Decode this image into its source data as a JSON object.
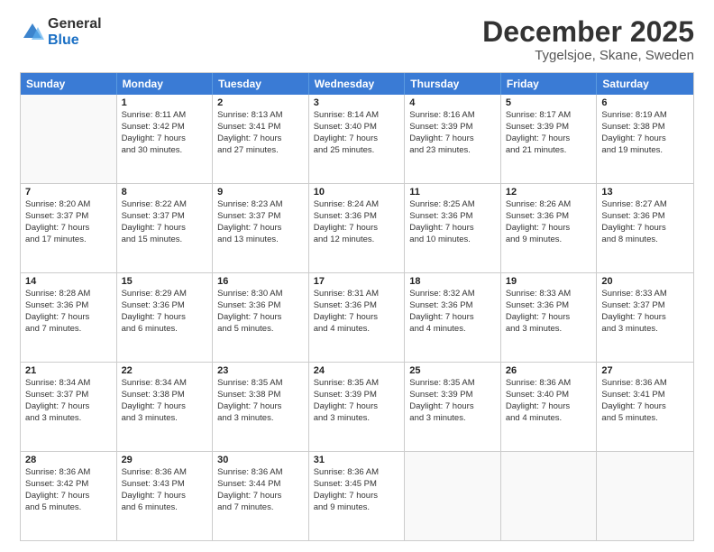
{
  "header": {
    "logo_general": "General",
    "logo_blue": "Blue",
    "month_title": "December 2025",
    "location": "Tygelsjoe, Skane, Sweden"
  },
  "days_of_week": [
    "Sunday",
    "Monday",
    "Tuesday",
    "Wednesday",
    "Thursday",
    "Friday",
    "Saturday"
  ],
  "weeks": [
    [
      {
        "day": "",
        "lines": []
      },
      {
        "day": "1",
        "lines": [
          "Sunrise: 8:11 AM",
          "Sunset: 3:42 PM",
          "Daylight: 7 hours",
          "and 30 minutes."
        ]
      },
      {
        "day": "2",
        "lines": [
          "Sunrise: 8:13 AM",
          "Sunset: 3:41 PM",
          "Daylight: 7 hours",
          "and 27 minutes."
        ]
      },
      {
        "day": "3",
        "lines": [
          "Sunrise: 8:14 AM",
          "Sunset: 3:40 PM",
          "Daylight: 7 hours",
          "and 25 minutes."
        ]
      },
      {
        "day": "4",
        "lines": [
          "Sunrise: 8:16 AM",
          "Sunset: 3:39 PM",
          "Daylight: 7 hours",
          "and 23 minutes."
        ]
      },
      {
        "day": "5",
        "lines": [
          "Sunrise: 8:17 AM",
          "Sunset: 3:39 PM",
          "Daylight: 7 hours",
          "and 21 minutes."
        ]
      },
      {
        "day": "6",
        "lines": [
          "Sunrise: 8:19 AM",
          "Sunset: 3:38 PM",
          "Daylight: 7 hours",
          "and 19 minutes."
        ]
      }
    ],
    [
      {
        "day": "7",
        "lines": [
          "Sunrise: 8:20 AM",
          "Sunset: 3:37 PM",
          "Daylight: 7 hours",
          "and 17 minutes."
        ]
      },
      {
        "day": "8",
        "lines": [
          "Sunrise: 8:22 AM",
          "Sunset: 3:37 PM",
          "Daylight: 7 hours",
          "and 15 minutes."
        ]
      },
      {
        "day": "9",
        "lines": [
          "Sunrise: 8:23 AM",
          "Sunset: 3:37 PM",
          "Daylight: 7 hours",
          "and 13 minutes."
        ]
      },
      {
        "day": "10",
        "lines": [
          "Sunrise: 8:24 AM",
          "Sunset: 3:36 PM",
          "Daylight: 7 hours",
          "and 12 minutes."
        ]
      },
      {
        "day": "11",
        "lines": [
          "Sunrise: 8:25 AM",
          "Sunset: 3:36 PM",
          "Daylight: 7 hours",
          "and 10 minutes."
        ]
      },
      {
        "day": "12",
        "lines": [
          "Sunrise: 8:26 AM",
          "Sunset: 3:36 PM",
          "Daylight: 7 hours",
          "and 9 minutes."
        ]
      },
      {
        "day": "13",
        "lines": [
          "Sunrise: 8:27 AM",
          "Sunset: 3:36 PM",
          "Daylight: 7 hours",
          "and 8 minutes."
        ]
      }
    ],
    [
      {
        "day": "14",
        "lines": [
          "Sunrise: 8:28 AM",
          "Sunset: 3:36 PM",
          "Daylight: 7 hours",
          "and 7 minutes."
        ]
      },
      {
        "day": "15",
        "lines": [
          "Sunrise: 8:29 AM",
          "Sunset: 3:36 PM",
          "Daylight: 7 hours",
          "and 6 minutes."
        ]
      },
      {
        "day": "16",
        "lines": [
          "Sunrise: 8:30 AM",
          "Sunset: 3:36 PM",
          "Daylight: 7 hours",
          "and 5 minutes."
        ]
      },
      {
        "day": "17",
        "lines": [
          "Sunrise: 8:31 AM",
          "Sunset: 3:36 PM",
          "Daylight: 7 hours",
          "and 4 minutes."
        ]
      },
      {
        "day": "18",
        "lines": [
          "Sunrise: 8:32 AM",
          "Sunset: 3:36 PM",
          "Daylight: 7 hours",
          "and 4 minutes."
        ]
      },
      {
        "day": "19",
        "lines": [
          "Sunrise: 8:33 AM",
          "Sunset: 3:36 PM",
          "Daylight: 7 hours",
          "and 3 minutes."
        ]
      },
      {
        "day": "20",
        "lines": [
          "Sunrise: 8:33 AM",
          "Sunset: 3:37 PM",
          "Daylight: 7 hours",
          "and 3 minutes."
        ]
      }
    ],
    [
      {
        "day": "21",
        "lines": [
          "Sunrise: 8:34 AM",
          "Sunset: 3:37 PM",
          "Daylight: 7 hours",
          "and 3 minutes."
        ]
      },
      {
        "day": "22",
        "lines": [
          "Sunrise: 8:34 AM",
          "Sunset: 3:38 PM",
          "Daylight: 7 hours",
          "and 3 minutes."
        ]
      },
      {
        "day": "23",
        "lines": [
          "Sunrise: 8:35 AM",
          "Sunset: 3:38 PM",
          "Daylight: 7 hours",
          "and 3 minutes."
        ]
      },
      {
        "day": "24",
        "lines": [
          "Sunrise: 8:35 AM",
          "Sunset: 3:39 PM",
          "Daylight: 7 hours",
          "and 3 minutes."
        ]
      },
      {
        "day": "25",
        "lines": [
          "Sunrise: 8:35 AM",
          "Sunset: 3:39 PM",
          "Daylight: 7 hours",
          "and 3 minutes."
        ]
      },
      {
        "day": "26",
        "lines": [
          "Sunrise: 8:36 AM",
          "Sunset: 3:40 PM",
          "Daylight: 7 hours",
          "and 4 minutes."
        ]
      },
      {
        "day": "27",
        "lines": [
          "Sunrise: 8:36 AM",
          "Sunset: 3:41 PM",
          "Daylight: 7 hours",
          "and 5 minutes."
        ]
      }
    ],
    [
      {
        "day": "28",
        "lines": [
          "Sunrise: 8:36 AM",
          "Sunset: 3:42 PM",
          "Daylight: 7 hours",
          "and 5 minutes."
        ]
      },
      {
        "day": "29",
        "lines": [
          "Sunrise: 8:36 AM",
          "Sunset: 3:43 PM",
          "Daylight: 7 hours",
          "and 6 minutes."
        ]
      },
      {
        "day": "30",
        "lines": [
          "Sunrise: 8:36 AM",
          "Sunset: 3:44 PM",
          "Daylight: 7 hours",
          "and 7 minutes."
        ]
      },
      {
        "day": "31",
        "lines": [
          "Sunrise: 8:36 AM",
          "Sunset: 3:45 PM",
          "Daylight: 7 hours",
          "and 9 minutes."
        ]
      },
      {
        "day": "",
        "lines": []
      },
      {
        "day": "",
        "lines": []
      },
      {
        "day": "",
        "lines": []
      }
    ]
  ]
}
